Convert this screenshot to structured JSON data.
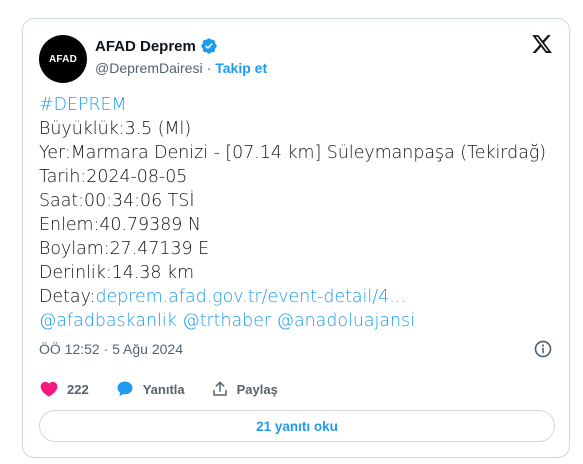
{
  "author": {
    "avatar_text": "AFAD",
    "display_name": "AFAD Deprem",
    "handle": "@DepremDairesi",
    "separator": "·",
    "follow_label": "Takip et",
    "verified": true
  },
  "tweet": {
    "lines": [
      {
        "text": "#DEPREM",
        "link": true
      },
      {
        "text": "Büyüklük:3.5 (Ml)",
        "link": false
      },
      {
        "text": "Yer:Marmara Denizi - [07.14 km] Süleymanpaşa (Tekirdağ)",
        "link": false
      },
      {
        "text": "Tarih:2024-08-05",
        "link": false
      },
      {
        "text": "Saat:00:34:06 TSİ",
        "link": false
      },
      {
        "text": "Enlem:40.79389 N",
        "link": false
      },
      {
        "text": "Boylam:27.47139 E",
        "link": false
      },
      {
        "text": "Derinlik:14.38 km",
        "link": false
      }
    ],
    "detail_label": "Detay:",
    "detail_link": "deprem.afad.gov.tr/event-detail/4…",
    "mentions": "@afadbaskanlik @trthaber @anadoluajansi"
  },
  "meta": {
    "timestamp": "ÖÖ 12:52 · 5 Ağu 2024"
  },
  "actions": {
    "like_count": "222",
    "reply_label": "Yanıtla",
    "share_label": "Paylaş"
  },
  "replies_button": {
    "label": "21 yanıtı oku"
  },
  "colors": {
    "accent": "#1d9bf0",
    "like": "#f91880",
    "text": "#0f1419",
    "secondary": "#536471",
    "border": "#cfd9de"
  },
  "icons": [
    "verified-badge-icon",
    "x-logo-icon",
    "info-icon",
    "heart-icon",
    "reply-bubble-icon",
    "share-icon"
  ]
}
